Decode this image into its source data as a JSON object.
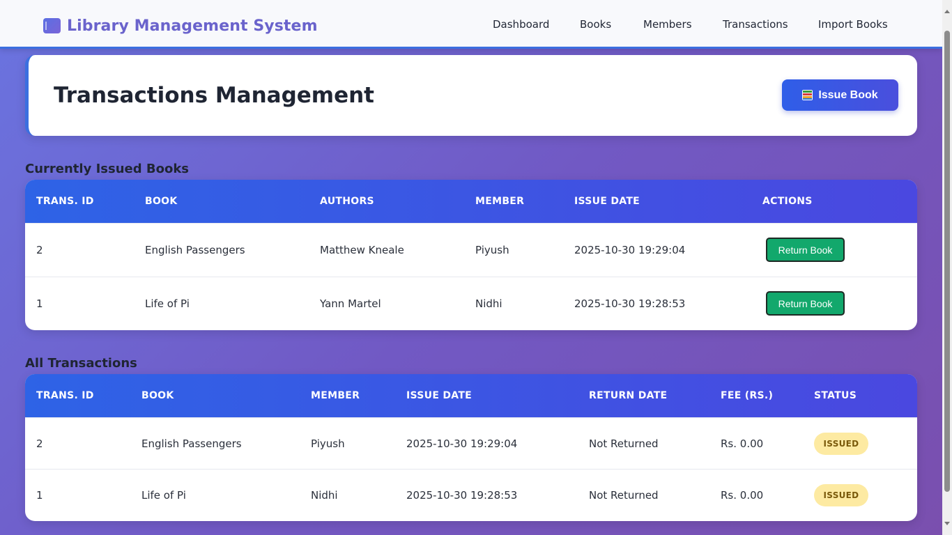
{
  "app": {
    "title": "Library Management System"
  },
  "nav": {
    "items": [
      "Dashboard",
      "Books",
      "Members",
      "Transactions",
      "Import Books"
    ]
  },
  "header": {
    "title": "Transactions Management",
    "issue_button": "Issue Book",
    "issue_icon": "books-icon"
  },
  "issued": {
    "title": "Currently Issued Books",
    "columns": [
      "TRANS. ID",
      "BOOK",
      "AUTHORS",
      "MEMBER",
      "ISSUE DATE",
      "ACTIONS"
    ],
    "rows": [
      {
        "id": "2",
        "book": "English Passengers",
        "authors": "Matthew Kneale",
        "member": "Piyush",
        "issue_date": "2025-10-30 19:29:04",
        "action": "Return Book"
      },
      {
        "id": "1",
        "book": "Life of Pi",
        "authors": "Yann Martel",
        "member": "Nidhi",
        "issue_date": "2025-10-30 19:28:53",
        "action": "Return Book"
      }
    ]
  },
  "all": {
    "title": "All Transactions",
    "columns": [
      "TRANS. ID",
      "BOOK",
      "MEMBER",
      "ISSUE DATE",
      "RETURN DATE",
      "FEE (RS.)",
      "STATUS"
    ],
    "rows": [
      {
        "id": "2",
        "book": "English Passengers",
        "member": "Piyush",
        "issue_date": "2025-10-30 19:29:04",
        "return_date": "Not Returned",
        "fee": "Rs. 0.00",
        "status": "ISSUED"
      },
      {
        "id": "1",
        "book": "Life of Pi",
        "member": "Nidhi",
        "issue_date": "2025-10-30 19:28:53",
        "return_date": "Not Returned",
        "fee": "Rs. 0.00",
        "status": "ISSUED"
      }
    ]
  },
  "colors": {
    "accent": "#3b6fe0",
    "brand": "#6a63cc",
    "return_button": "#12a86c",
    "status_issued_bg": "#fdeaa2"
  }
}
